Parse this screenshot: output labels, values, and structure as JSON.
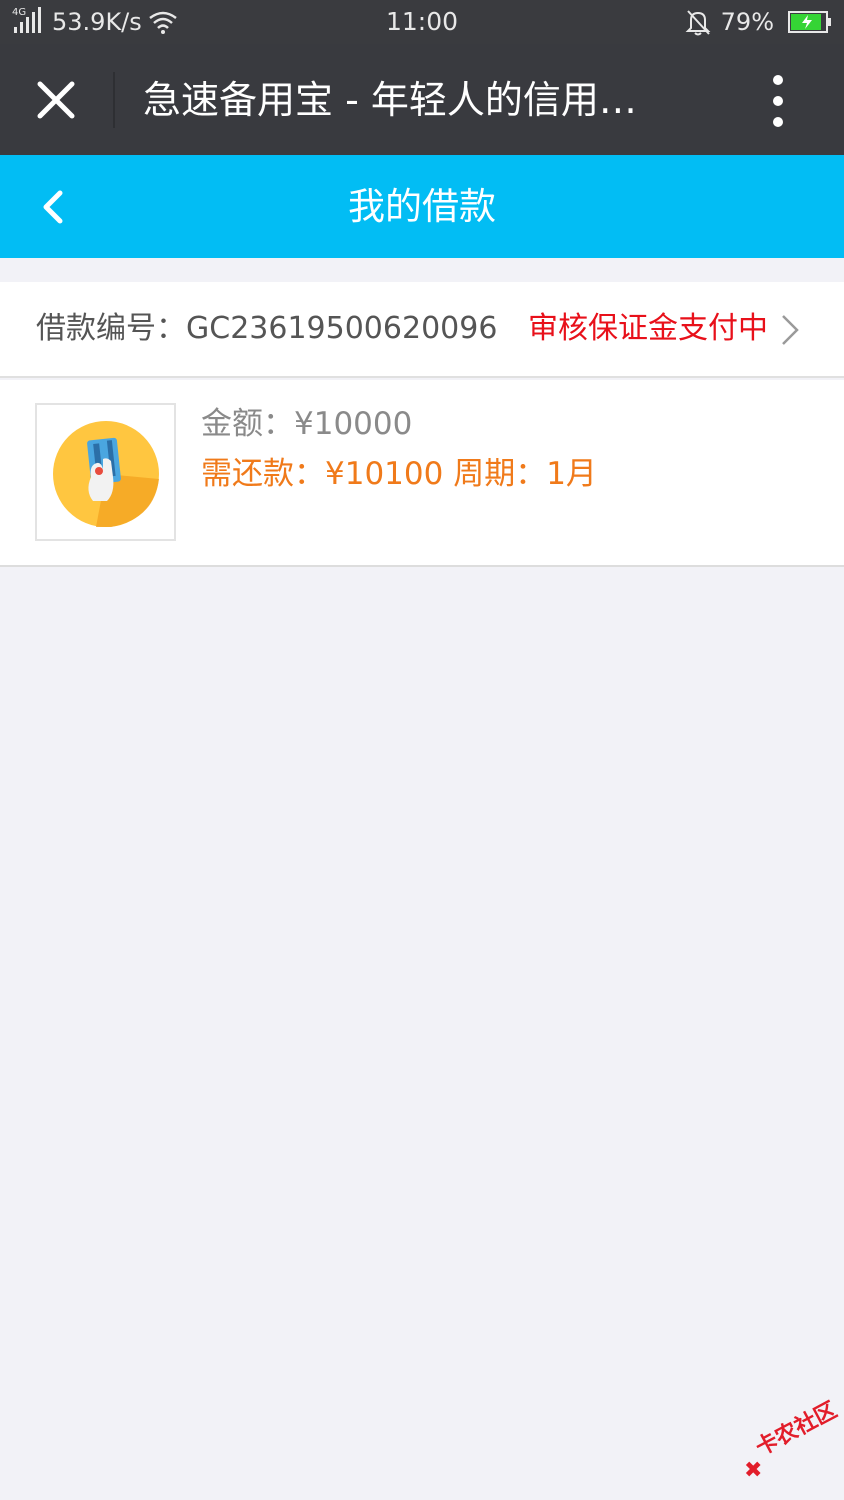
{
  "status_bar": {
    "network": "4G",
    "speed": "53.9K/s",
    "time": "11:00",
    "battery": "79%"
  },
  "browser": {
    "title": "急速备用宝 - 年轻人的信用…"
  },
  "header": {
    "title": "我的借款"
  },
  "loan": {
    "number_label": "借款编号：GC23619500620096",
    "status": "审核保证金支付中",
    "amount": "金额：¥10000",
    "repayment": "需还款：¥10100 周期：1月"
  },
  "watermark": {
    "text": "卡农社区"
  },
  "colors": {
    "accent": "#02bdf4",
    "status_red": "#e8101a",
    "repay_orange": "#f07a1a",
    "browser_bar": "#393a3f"
  }
}
